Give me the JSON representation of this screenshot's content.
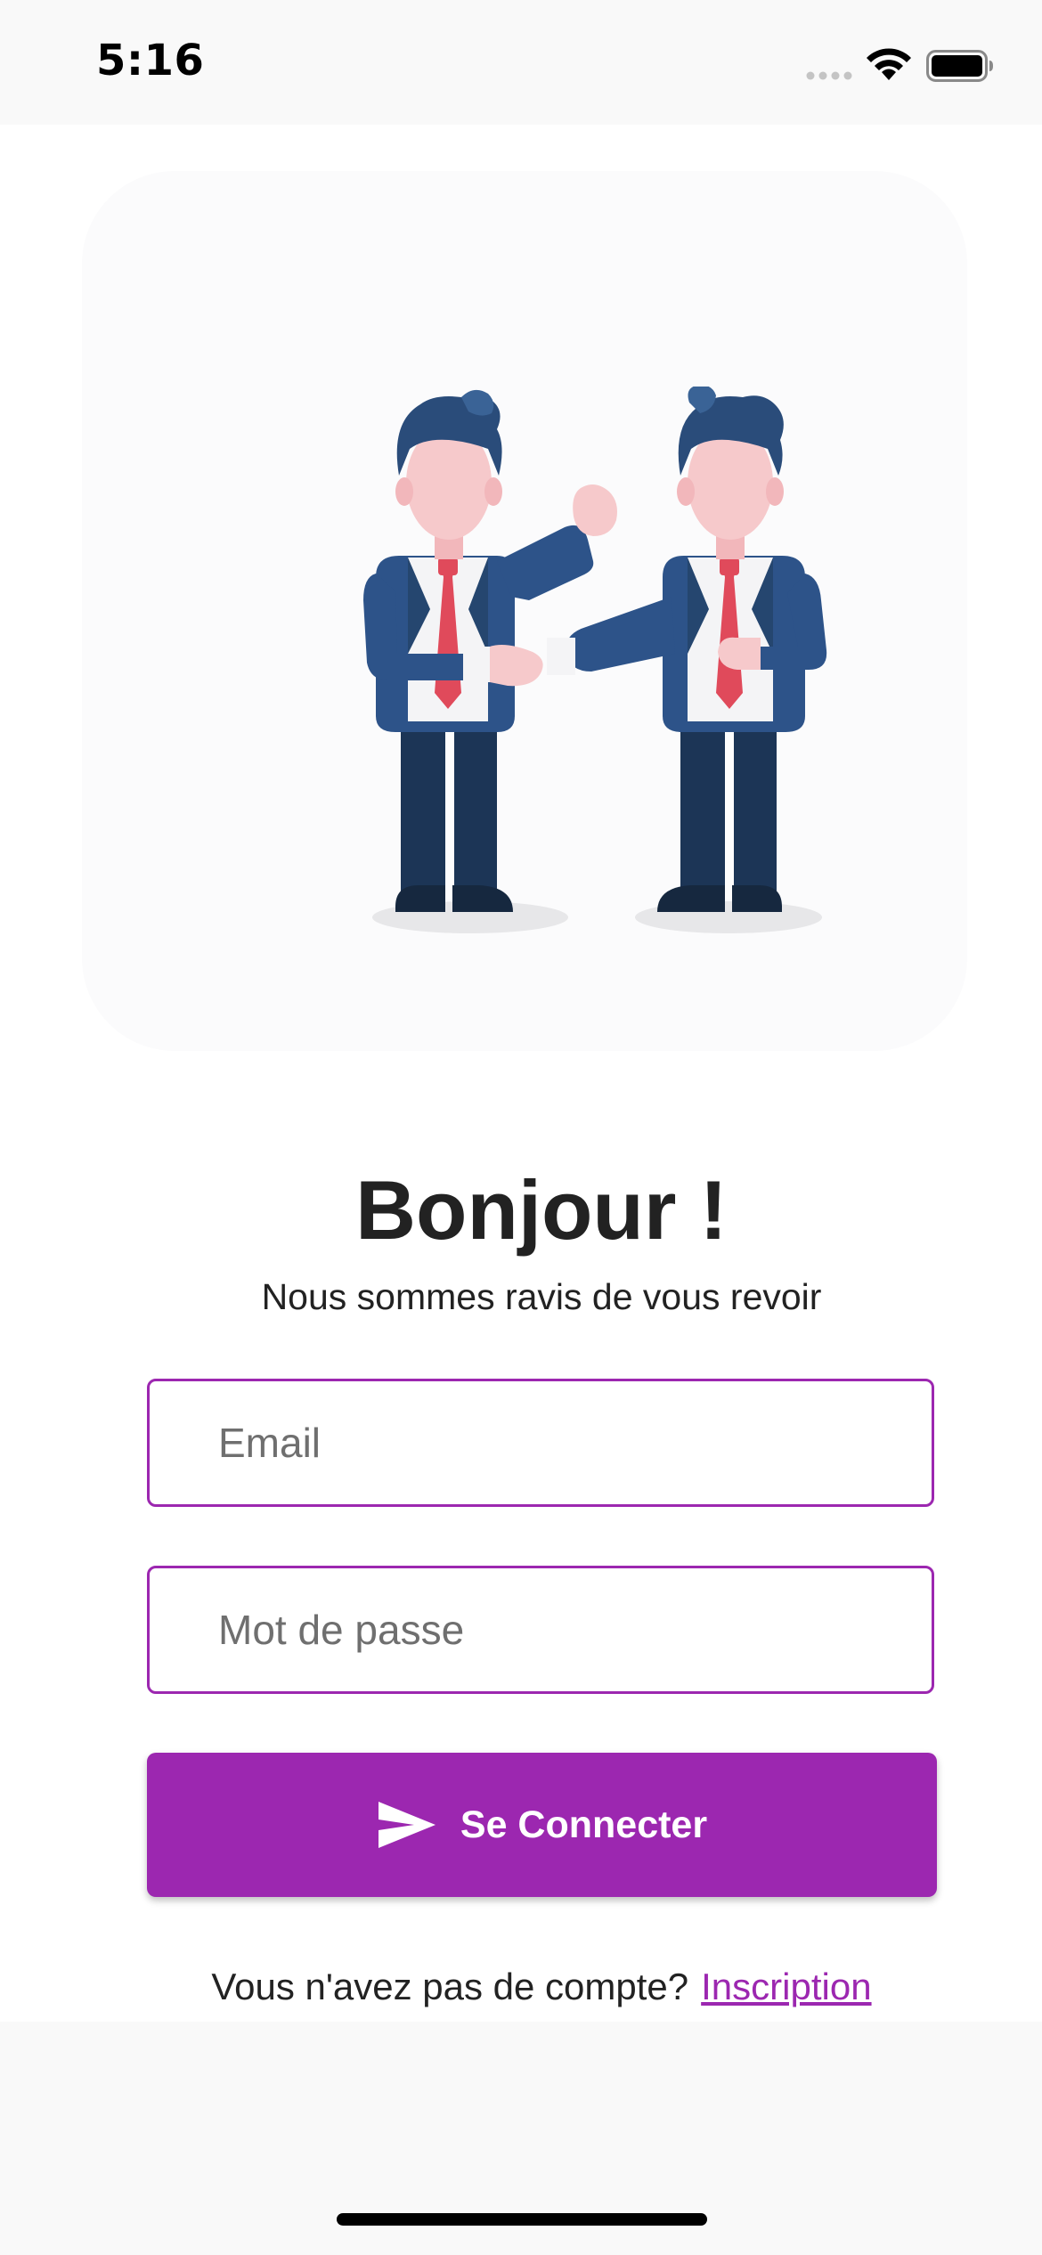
{
  "status_bar": {
    "time": "5:16"
  },
  "hero": {
    "image": "two-businessmen-handshake-illustration"
  },
  "login": {
    "title": "Bonjour !",
    "subtitle": "Nous sommes ravis de vous revoir",
    "email_placeholder": "Email",
    "password_placeholder": "Mot de passe",
    "submit_label": "Se Connecter",
    "submit_icon": "send-icon",
    "signup_prompt": "Vous n'avez pas de compte?",
    "signup_link": "Inscription"
  },
  "colors": {
    "accent": "#9c27b0",
    "background": "#ffffff",
    "system_bar": "#f9f9f9",
    "text": "#222222"
  }
}
